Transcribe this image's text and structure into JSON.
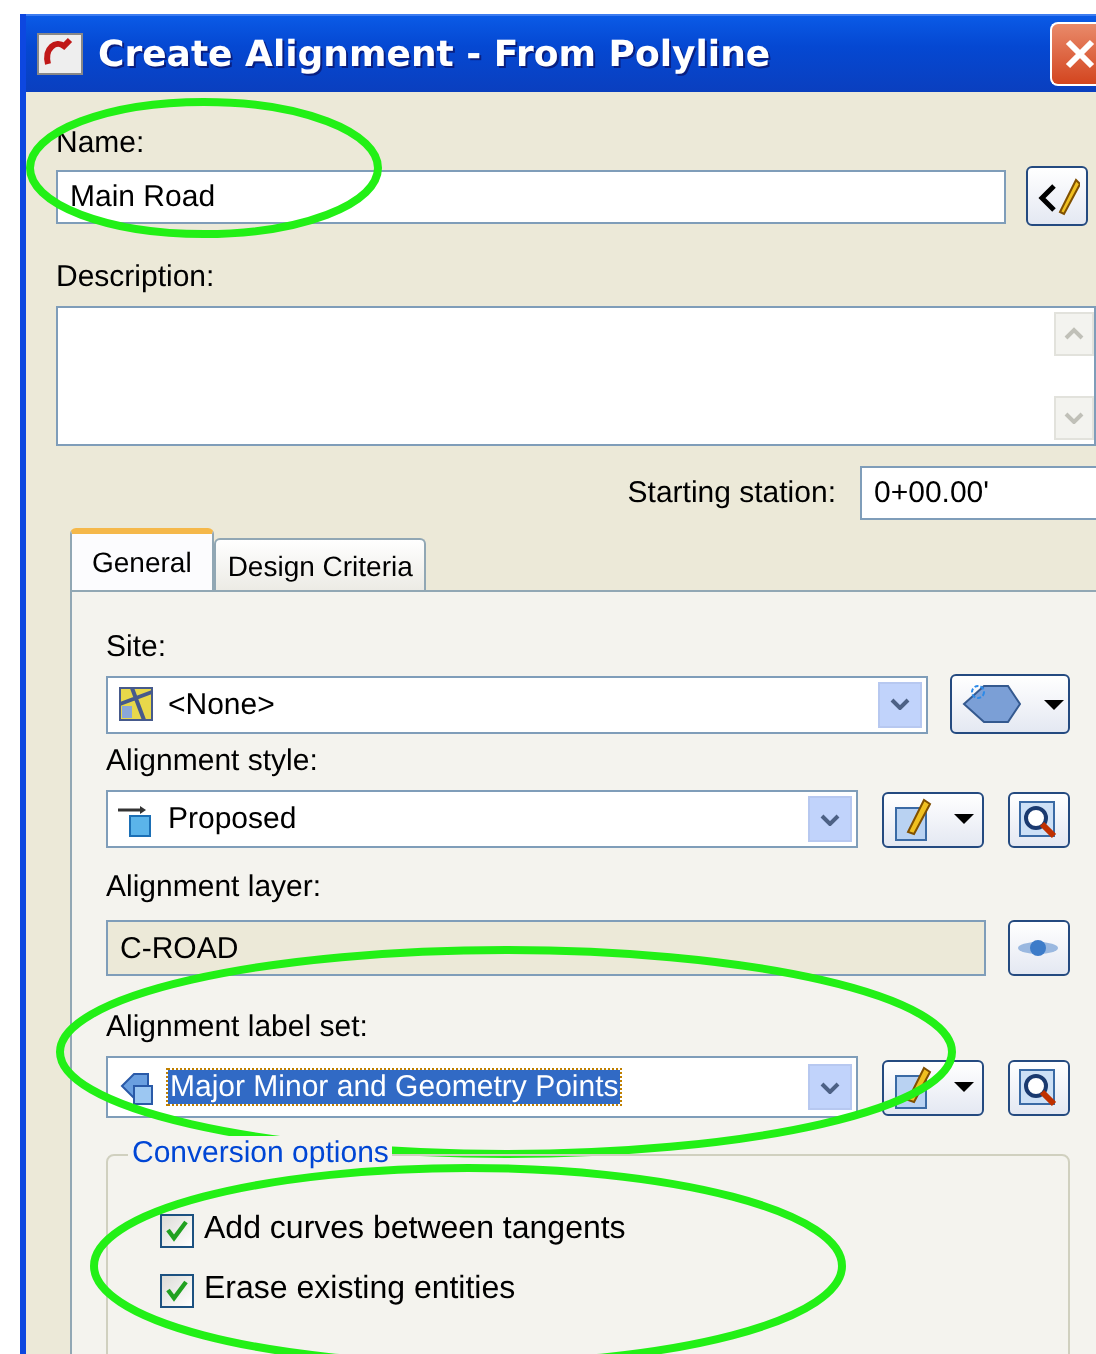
{
  "window": {
    "title": "Create Alignment - From Polyline"
  },
  "name": {
    "label": "Name:",
    "value": "Main Road",
    "highlighted": true
  },
  "description": {
    "label": "Description:"
  },
  "starting_station": {
    "label": "Starting station:",
    "value": "0+00.00'"
  },
  "tabs": [
    {
      "label": "General",
      "selected": true
    },
    {
      "label": "Design Criteria",
      "selected": false
    }
  ],
  "site": {
    "label": "Site:",
    "value": "<None>"
  },
  "alignment_style": {
    "label": "Alignment style:",
    "value": "Proposed"
  },
  "alignment_layer": {
    "label": "Alignment layer:",
    "value": "C-ROAD",
    "disabled": true
  },
  "alignment_label_set": {
    "label": "Alignment label set:",
    "value": "Major Minor and Geometry Points",
    "selected": true,
    "highlighted": true
  },
  "conversion_options": {
    "title": "Conversion options",
    "highlighted": true,
    "options": [
      {
        "label": "Add curves between tangents",
        "checked": true
      },
      {
        "label": "Erase existing entities",
        "checked": true
      }
    ]
  }
}
